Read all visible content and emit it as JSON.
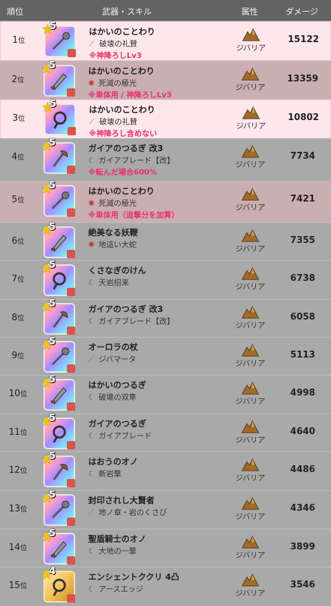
{
  "header": {
    "rank": "順位",
    "weapon_skill": "武器・スキル",
    "attribute": "属性",
    "damage": "ダメージ"
  },
  "rank_suffix": "位",
  "rows": [
    {
      "rank": "1",
      "name": "はかいのことわり",
      "skill": "破壊の礼賛",
      "skill_icon": "rod-icon",
      "note": "※神降ろしLv3",
      "attr": "ジバリア",
      "damage": "15122",
      "stars": "5",
      "style": "hl"
    },
    {
      "rank": "2",
      "name": "はかいのことわり",
      "skill": "死滅の極光",
      "skill_icon": "burst-icon",
      "note": "※単体用 / 神降ろしLv3",
      "attr": "ジバリア",
      "damage": "13359",
      "stars": "5",
      "style": "pinkdark"
    },
    {
      "rank": "3",
      "name": "はかいのことわり",
      "skill": "破壊の礼賛",
      "skill_icon": "rod-icon",
      "note": "※神降ろし含めない",
      "attr": "ジバリア",
      "damage": "10802",
      "stars": "5",
      "style": "hl"
    },
    {
      "rank": "4",
      "name": "ガイアのつるぎ 改3",
      "skill": "ガイアブレード【改】",
      "skill_icon": "crescent-icon",
      "note": "※転んだ場合600%",
      "attr": "ジバリア",
      "damage": "7734",
      "stars": "5",
      "style": "gray"
    },
    {
      "rank": "5",
      "name": "はかいのことわり",
      "skill": "死滅の極光",
      "skill_icon": "burst-icon",
      "note": "※単体用（追撃分を加算）",
      "attr": "ジバリア",
      "damage": "7421",
      "stars": "5",
      "style": "pinkdark"
    },
    {
      "rank": "6",
      "name": "絶美なる妖鞭",
      "skill": "地這い大蛇",
      "skill_icon": "burst-icon",
      "note": "",
      "attr": "ジバリア",
      "damage": "7355",
      "stars": "5",
      "style": "gray"
    },
    {
      "rank": "7",
      "name": "くさなぎのけん",
      "skill": "天岩招来",
      "skill_icon": "crescent-icon",
      "note": "",
      "attr": "ジバリア",
      "damage": "6738",
      "stars": "5",
      "style": "gray"
    },
    {
      "rank": "8",
      "name": "ガイアのつるぎ 改3",
      "skill": "ガイアブレード【改】",
      "skill_icon": "crescent-icon",
      "note": "",
      "attr": "ジバリア",
      "damage": "6058",
      "stars": "5",
      "style": "gray"
    },
    {
      "rank": "9",
      "name": "オーロラの杖",
      "skill": "ジバマータ",
      "skill_icon": "rod-icon",
      "note": "",
      "attr": "ジバリア",
      "damage": "5113",
      "stars": "5",
      "style": "gray"
    },
    {
      "rank": "10",
      "name": "はかいのつるぎ",
      "skill": "破壊の双隼",
      "skill_icon": "crescent-icon",
      "note": "",
      "attr": "ジバリア",
      "damage": "4998",
      "stars": "5",
      "style": "gray"
    },
    {
      "rank": "11",
      "name": "ガイアのつるぎ",
      "skill": "ガイアブレード",
      "skill_icon": "crescent-icon",
      "note": "",
      "attr": "ジバリア",
      "damage": "4640",
      "stars": "5",
      "style": "gray"
    },
    {
      "rank": "12",
      "name": "はおうのオノ",
      "skill": "新岩撃",
      "skill_icon": "crescent-icon",
      "note": "",
      "attr": "ジバリア",
      "damage": "4486",
      "stars": "5",
      "style": "gray"
    },
    {
      "rank": "13",
      "name": "封印されし大賢者",
      "skill": "地ノ章・岩のくさび",
      "skill_icon": "rod-icon",
      "note": "",
      "attr": "ジバリア",
      "damage": "4346",
      "stars": "5",
      "style": "gray"
    },
    {
      "rank": "14",
      "name": "聖盾騎士のオノ",
      "skill": "大地の一撃",
      "skill_icon": "crescent-icon",
      "note": "",
      "attr": "ジバリア",
      "damage": "3899",
      "stars": "5",
      "style": "gray"
    },
    {
      "rank": "15",
      "name": "エンシェントククリ 4凸",
      "skill": "アースエッジ",
      "skill_icon": "crescent-icon",
      "note": "",
      "attr": "ジバリア",
      "damage": "3546",
      "stars": "4",
      "style": "gray"
    }
  ]
}
